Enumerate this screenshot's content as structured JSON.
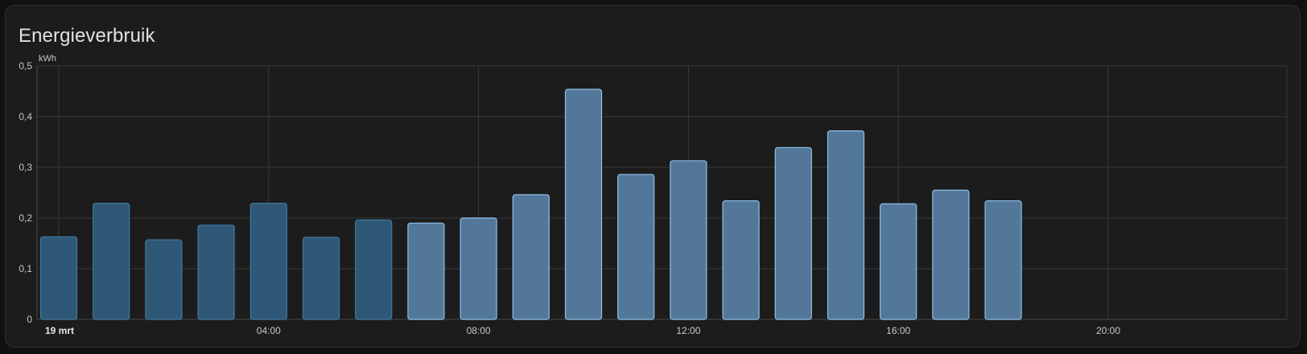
{
  "card": {
    "title": "Energieverbruik"
  },
  "chart_data": {
    "type": "bar",
    "title": "Energieverbruik",
    "ylabel": "kWh",
    "ylim": [
      0,
      0.5
    ],
    "y_ticks": [
      "0",
      "0,1",
      "0,2",
      "0,3",
      "0,4",
      "0,5"
    ],
    "x_ticks": [
      {
        "label": "19 mrt",
        "hour": 0,
        "bold": true
      },
      {
        "label": "04:00",
        "hour": 4,
        "bold": false
      },
      {
        "label": "08:00",
        "hour": 8,
        "bold": false
      },
      {
        "label": "12:00",
        "hour": 12,
        "bold": false
      },
      {
        "label": "16:00",
        "hour": 16,
        "bold": false
      },
      {
        "label": "20:00",
        "hour": 20,
        "bold": false
      }
    ],
    "x_range_hours": [
      0,
      24
    ],
    "grid": true,
    "series": [
      {
        "hours": [
          0,
          1,
          2,
          3,
          4,
          5,
          6,
          7,
          8,
          9,
          10,
          11,
          12,
          13,
          14,
          15,
          16,
          17,
          18
        ],
        "values": [
          0.163,
          0.229,
          0.157,
          0.186,
          0.229,
          0.162,
          0.196,
          0.19,
          0.2,
          0.246,
          0.454,
          0.286,
          0.313,
          0.234,
          0.339,
          0.372,
          0.228,
          0.255,
          0.234
        ],
        "kind": [
          "dark",
          "dark",
          "dark",
          "dark",
          "dark",
          "dark",
          "dark",
          "light",
          "light",
          "light",
          "light",
          "light",
          "light",
          "light",
          "light",
          "light",
          "light",
          "light",
          "light"
        ]
      }
    ],
    "colors": {
      "dark_fill": "#2f5876",
      "dark_stroke": "#3f7aa1",
      "light_fill": "#537799",
      "light_stroke": "#8ec1ec",
      "grid": "#3a3a3a",
      "axis": "#4a4a4a"
    }
  }
}
